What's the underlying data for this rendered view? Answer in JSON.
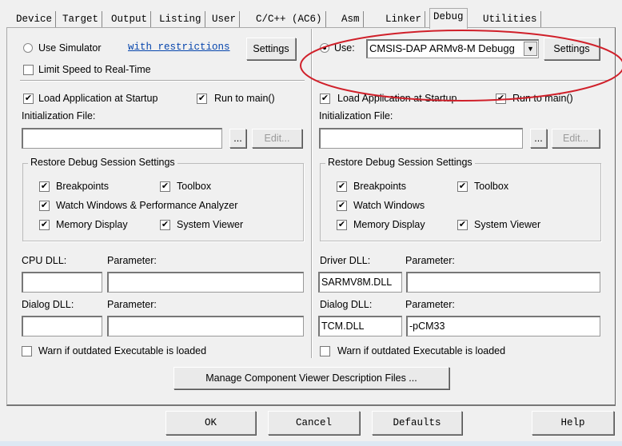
{
  "tabs": [
    "Device",
    "Target",
    "Output",
    "Listing",
    "User",
    "C/C++ (AC6)",
    "Asm",
    "Linker",
    "Debug",
    "Utilities"
  ],
  "active_tab": "Debug",
  "left": {
    "use_simulator": "Use Simulator",
    "use_simulator_selected": false,
    "restrictions_link": "with restrictions",
    "settings": "Settings",
    "limit_speed": "Limit Speed to Real-Time",
    "limit_speed_checked": false,
    "load_app": "Load Application at Startup",
    "run_to_main": "Run to main()",
    "init_file_label": "Initialization File:",
    "init_file_value": "",
    "browse": "...",
    "edit": "Edit...",
    "restore_group": "Restore Debug Session Settings",
    "breakpoints": "Breakpoints",
    "toolbox": "Toolbox",
    "watch": "Watch Windows & Performance Analyzer",
    "memory": "Memory Display",
    "system_viewer": "System Viewer",
    "cpu_dll_label": "CPU DLL:",
    "parameter_label": "Parameter:",
    "cpu_dll": "",
    "cpu_param": "",
    "dialog_dll_label": "Dialog DLL:",
    "dialog_dll": "",
    "dialog_param": "",
    "warn": "Warn if outdated Executable is loaded"
  },
  "right": {
    "use": "Use:",
    "use_selected": true,
    "debugger": "CMSIS-DAP ARMv8-M Debugg",
    "settings": "Settings",
    "load_app": "Load Application at Startup",
    "run_to_main": "Run to main()",
    "init_file_label": "Initialization File:",
    "init_file_value": "",
    "browse": "...",
    "edit": "Edit...",
    "restore_group": "Restore Debug Session Settings",
    "breakpoints": "Breakpoints",
    "toolbox": "Toolbox",
    "watch": "Watch Windows",
    "memory": "Memory Display",
    "system_viewer": "System Viewer",
    "driver_dll_label": "Driver DLL:",
    "parameter_label": "Parameter:",
    "driver_dll": "SARMV8M.DLL",
    "driver_param": "",
    "dialog_dll_label": "Dialog DLL:",
    "dialog_dll": "TCM.DLL",
    "dialog_param": "-pCM33",
    "warn": "Warn if outdated Executable is loaded"
  },
  "manage_button": "Manage Component Viewer Description Files ...",
  "footer": {
    "ok": "OK",
    "cancel": "Cancel",
    "defaults": "Defaults",
    "help": "Help"
  },
  "colors": {
    "annotation": "#d0202a",
    "link": "#0645ad"
  }
}
